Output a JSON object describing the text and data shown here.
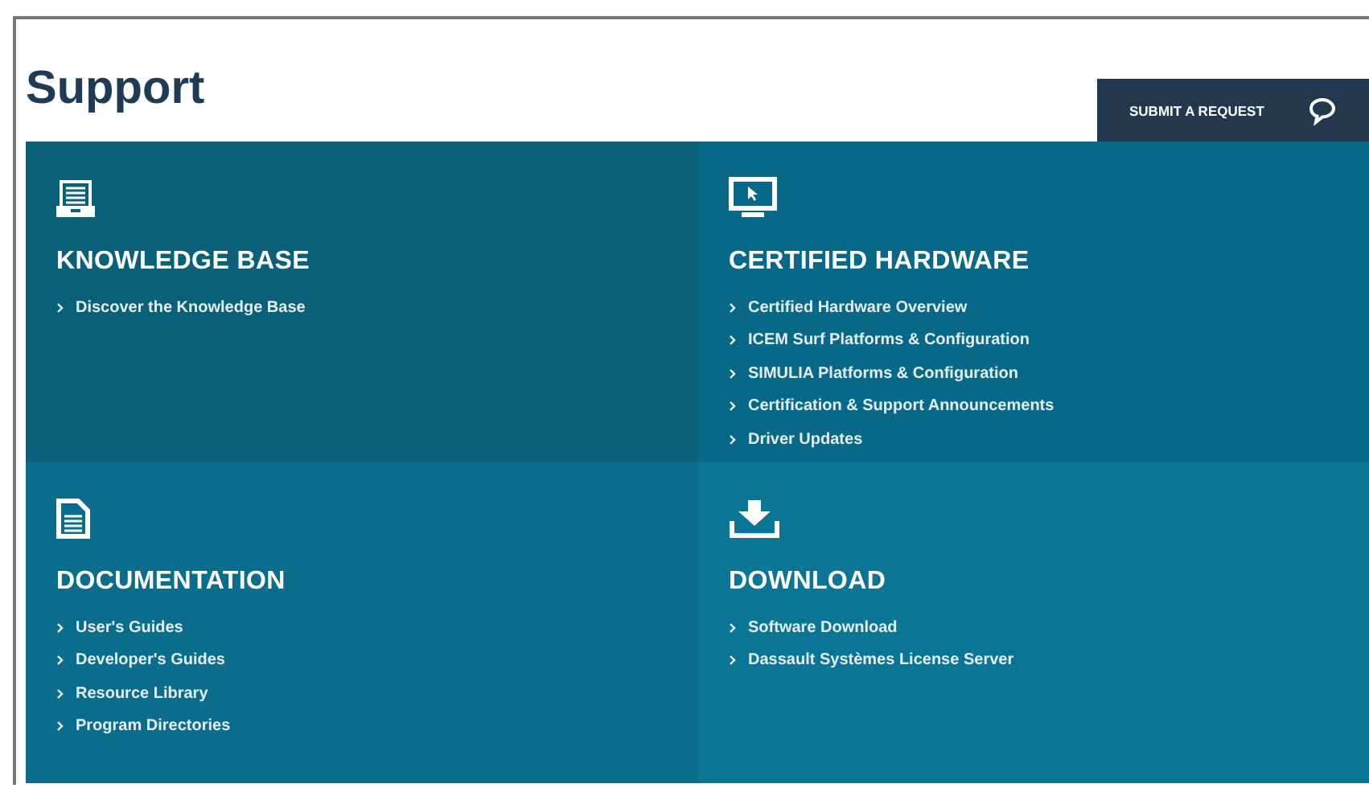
{
  "page": {
    "title": "Support"
  },
  "submit_button": {
    "label": "SUBMIT A REQUEST"
  },
  "panels": [
    {
      "kind": "knowledge",
      "color": "#0b6079",
      "heading": "KNOWLEDGE BASE",
      "links": [
        "Discover the Knowledge Base"
      ]
    },
    {
      "kind": "hardware",
      "color": "#076887",
      "heading": "CERTIFIED HARDWARE",
      "links": [
        "Certified Hardware Overview",
        "ICEM Surf Platforms & Configuration",
        "SIMULIA Platforms & Configuration",
        "Certification & Support Announcements",
        "Driver Updates"
      ]
    },
    {
      "kind": "documentation",
      "color": "#0b6d8c",
      "heading": "DOCUMENTATION",
      "links": [
        "User's Guides",
        "Developer's Guides",
        "Resource Library",
        "Program Directories"
      ]
    },
    {
      "kind": "download",
      "color": "#0b7596",
      "heading": "DOWNLOAD",
      "links": [
        "Software Download",
        "Dassault Systèmes License Server"
      ]
    }
  ]
}
